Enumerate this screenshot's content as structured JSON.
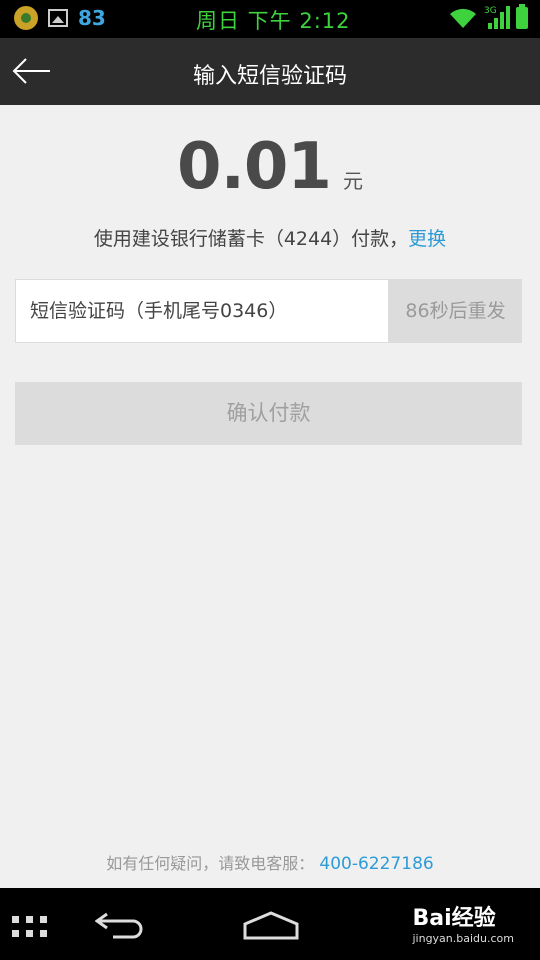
{
  "status_bar": {
    "notification_count": "83",
    "time": "周日 下午 2:12",
    "network": "3G",
    "colors": {
      "time": "#3fd23f",
      "count": "#3ea7e0"
    }
  },
  "header": {
    "title": "输入短信验证码"
  },
  "payment": {
    "amount": "0.01",
    "unit": "元",
    "method_text": "使用建设银行储蓄卡（4244）付款，",
    "change_link": "更换"
  },
  "sms": {
    "placeholder": "短信验证码（手机尾号0346）",
    "value": "",
    "resend_label": "86秒后重发"
  },
  "confirm_label": "确认付款",
  "support": {
    "text": "如有任何疑问，请致电客服：",
    "phone": "400-6227186"
  },
  "watermark": {
    "brand": "Bai经验",
    "url": "jingyan.baidu.com"
  },
  "colors": {
    "accent": "#2e9bd6",
    "header_bg": "#2c2c2c",
    "disabled_bg": "#dcdcdc"
  }
}
